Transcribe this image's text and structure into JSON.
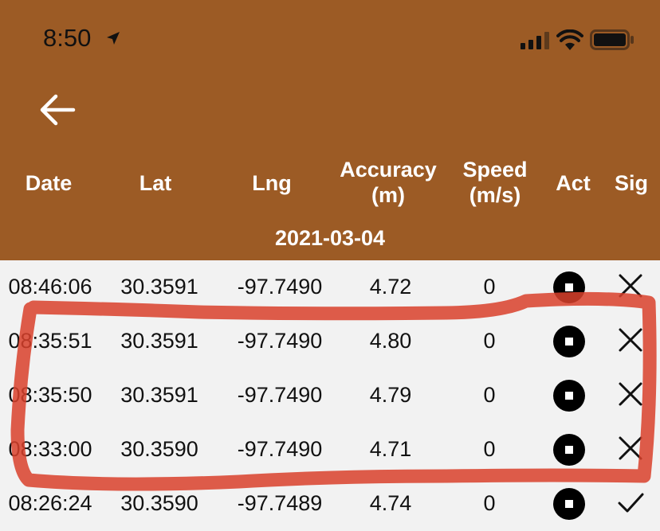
{
  "status_bar": {
    "time": "8:50"
  },
  "table": {
    "headers": {
      "date": "Date",
      "lat": "Lat",
      "lng": "Lng",
      "accuracy_l1": "Accuracy",
      "accuracy_l2": "(m)",
      "speed_l1": "Speed",
      "speed_l2": "(m/s)",
      "act": "Act",
      "sig": "Sig"
    },
    "group_date": "2021-03-04",
    "rows": [
      {
        "time": "08:46:06",
        "lat": "30.3591",
        "lng": "-97.7490",
        "accuracy": "4.72",
        "speed": "0",
        "sig": "x"
      },
      {
        "time": "08:35:51",
        "lat": "30.3591",
        "lng": "-97.7490",
        "accuracy": "4.80",
        "speed": "0",
        "sig": "x"
      },
      {
        "time": "08:35:50",
        "lat": "30.3591",
        "lng": "-97.7490",
        "accuracy": "4.79",
        "speed": "0",
        "sig": "x"
      },
      {
        "time": "08:33:00",
        "lat": "30.3590",
        "lng": "-97.7490",
        "accuracy": "4.71",
        "speed": "0",
        "sig": "x"
      },
      {
        "time": "08:26:24",
        "lat": "30.3590",
        "lng": "-97.7489",
        "accuracy": "4.74",
        "speed": "0",
        "sig": "check"
      }
    ]
  },
  "colors": {
    "header_bg": "#9c5b25",
    "row_bg": "#f2f2f2",
    "highlight": "#d9412c"
  }
}
